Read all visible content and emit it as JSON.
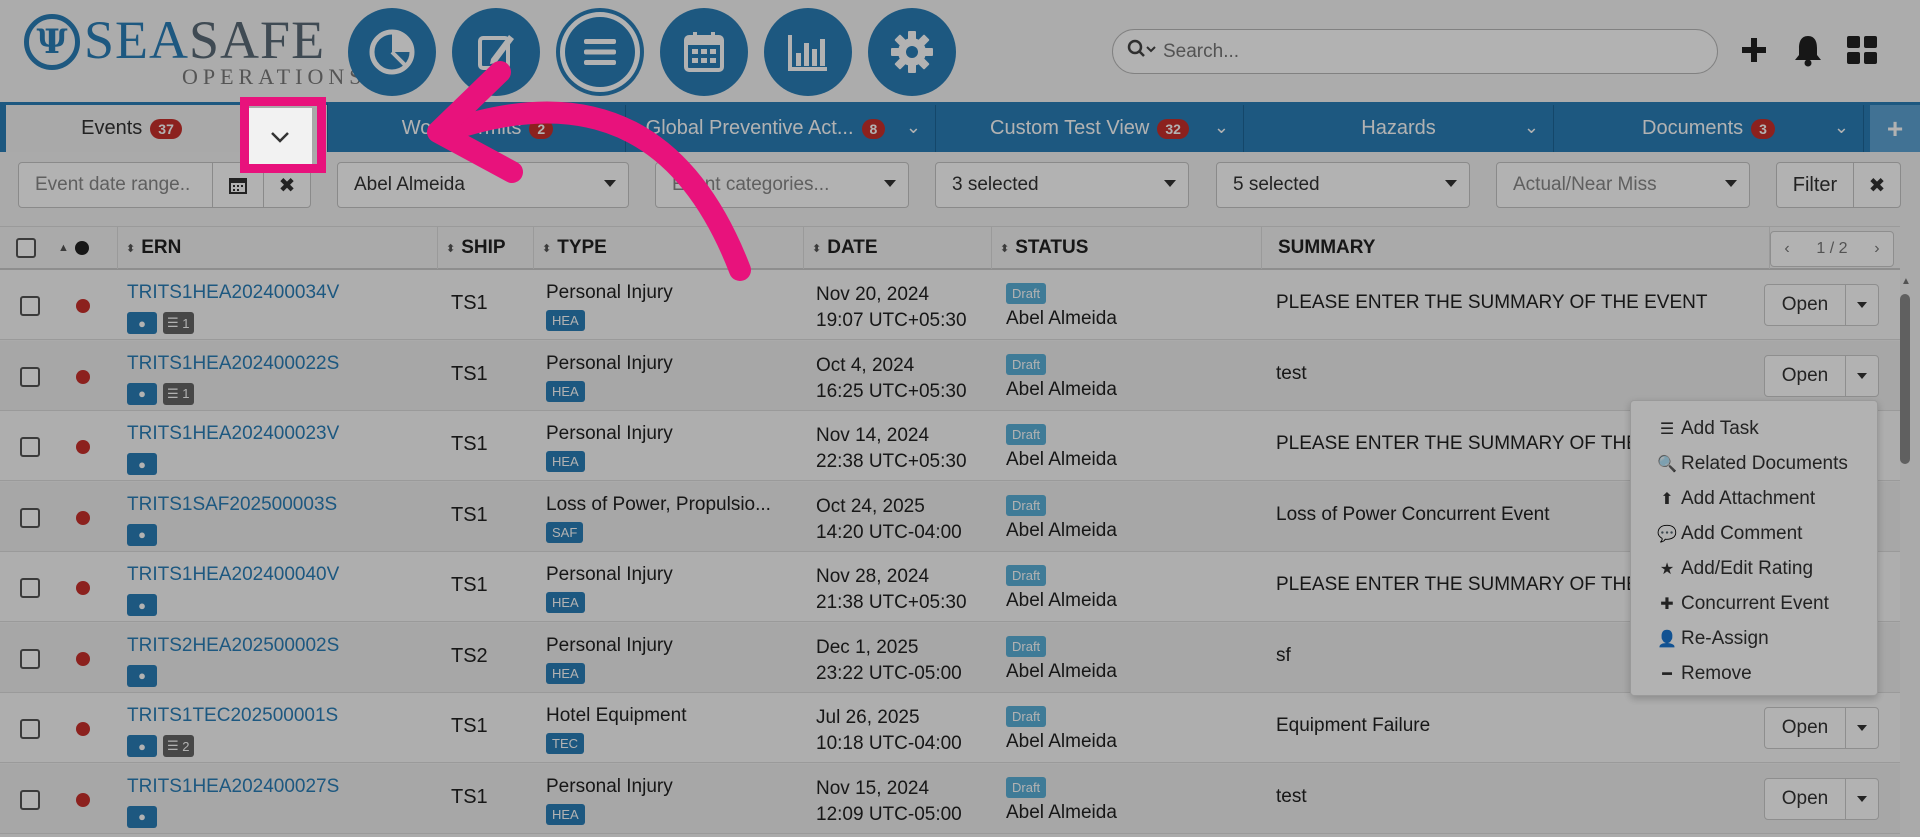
{
  "logo": {
    "sea": "SEA",
    "safe": "SAFE",
    "sub": "OPERATIONS",
    "symbol": "Ψ"
  },
  "nav": [
    {
      "icon": "pie-chart-icon"
    },
    {
      "icon": "edit-icon"
    },
    {
      "icon": "list-icon"
    },
    {
      "icon": "calendar-icon"
    },
    {
      "icon": "bar-chart-icon"
    },
    {
      "icon": "gear-icon"
    }
  ],
  "search": {
    "placeholder": "Search..."
  },
  "tabs": [
    {
      "label": "Events",
      "badge": "37"
    },
    {
      "label": "Work Permits",
      "badge": "2"
    },
    {
      "label": "Global Preventive Act...",
      "badge": "8"
    },
    {
      "label": "Custom Test View",
      "badge": "32"
    },
    {
      "label": "Hazards",
      "badge": ""
    },
    {
      "label": "Documents",
      "badge": "3"
    }
  ],
  "filters": {
    "date_placeholder": "Event date range..",
    "user": "Abel Almeida",
    "categories_placeholder": "Event categories...",
    "select1": "3 selected",
    "select2": "5 selected",
    "actual_placeholder": "Actual/Near Miss",
    "filter_label": "Filter",
    "clear": "✖"
  },
  "table": {
    "headers": {
      "ern": "ERN",
      "ship": "SHIP",
      "type": "TYPE",
      "date": "DATE",
      "status": "STATUS",
      "summary": "SUMMARY"
    },
    "pager": "1 / 2",
    "rows": [
      {
        "ern": "TRITS1HEA202400034V",
        "tasks": "1",
        "ship": "TS1",
        "type": "Personal Injury",
        "cat": "HEA",
        "date1": "Nov 20, 2024",
        "date2": "19:07 UTC+05:30",
        "status": "Draft",
        "who": "Abel Almeida",
        "summary": "PLEASE ENTER THE SUMMARY OF THE EVENT"
      },
      {
        "ern": "TRITS1HEA202400022S",
        "tasks": "1",
        "ship": "TS1",
        "type": "Personal Injury",
        "cat": "HEA",
        "date1": "Oct 4, 2024",
        "date2": "16:25 UTC+05:30",
        "status": "Draft",
        "who": "Abel Almeida",
        "summary": "test"
      },
      {
        "ern": "TRITS1HEA202400023V",
        "tasks": "",
        "ship": "TS1",
        "type": "Personal Injury",
        "cat": "HEA",
        "date1": "Nov 14, 2024",
        "date2": "22:38 UTC+05:30",
        "status": "Draft",
        "who": "Abel Almeida",
        "summary": "PLEASE ENTER THE SUMMARY OF THE EV"
      },
      {
        "ern": "TRITS1SAF202500003S",
        "tasks": "",
        "ship": "TS1",
        "type": "Loss of Power, Propulsio...",
        "cat": "SAF",
        "date1": "Oct 24, 2025",
        "date2": "14:20 UTC-04:00",
        "status": "Draft",
        "who": "Abel Almeida",
        "summary": "Loss of Power Concurrent Event"
      },
      {
        "ern": "TRITS1HEA202400040V",
        "tasks": "",
        "ship": "TS1",
        "type": "Personal Injury",
        "cat": "HEA",
        "date1": "Nov 28, 2024",
        "date2": "21:38 UTC+05:30",
        "status": "Draft",
        "who": "Abel Almeida",
        "summary": "PLEASE ENTER THE SUMMARY OF THE EV"
      },
      {
        "ern": "TRITS2HEA202500002S",
        "tasks": "",
        "ship": "TS2",
        "type": "Personal Injury",
        "cat": "HEA",
        "date1": "Dec 1, 2025",
        "date2": "23:22 UTC-05:00",
        "status": "Draft",
        "who": "Abel Almeida",
        "summary": "sf"
      },
      {
        "ern": "TRITS1TEC202500001S",
        "tasks": "2",
        "ship": "TS1",
        "type": "Hotel Equipment",
        "cat": "TEC",
        "date1": "Jul 26, 2025",
        "date2": "10:18 UTC-04:00",
        "status": "Draft",
        "who": "Abel Almeida",
        "summary": "Equipment Failure"
      },
      {
        "ern": "TRITS1HEA202400027S",
        "tasks": "",
        "ship": "TS1",
        "type": "Personal Injury",
        "cat": "HEA",
        "date1": "Nov 15, 2024",
        "date2": "12:09 UTC-05:00",
        "status": "Draft",
        "who": "Abel Almeida",
        "summary": "test"
      }
    ],
    "open_label": "Open"
  },
  "menu": [
    {
      "icon": "tasks-icon",
      "glyph": "☰",
      "label": "Add Task"
    },
    {
      "icon": "search-icon",
      "glyph": "🔍",
      "label": "Related Documents"
    },
    {
      "icon": "upload-icon",
      "glyph": "⬆",
      "label": "Add Attachment"
    },
    {
      "icon": "comment-icon",
      "glyph": "💬",
      "label": "Add Comment"
    },
    {
      "icon": "star-icon",
      "glyph": "★",
      "label": "Add/Edit Rating"
    },
    {
      "icon": "plus-icon",
      "glyph": "✚",
      "label": "Concurrent Event"
    },
    {
      "icon": "user-icon",
      "glyph": "👤",
      "label": "Re-Assign"
    },
    {
      "icon": "minus-icon",
      "glyph": "━",
      "label": "Remove"
    }
  ],
  "colors": {
    "accent": "#2a7fb8",
    "highlight": "#e8127c",
    "badge": "#c9302c",
    "status": "#5bb0d8"
  }
}
